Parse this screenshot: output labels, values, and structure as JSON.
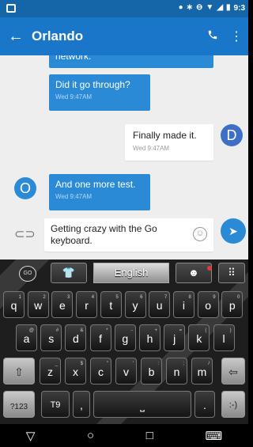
{
  "status_bar": {
    "time": "9:3",
    "icons": [
      "notification-icon",
      "bluetooth-icon",
      "sync-icon",
      "wifi-icon",
      "signal-icon",
      "battery-icon"
    ]
  },
  "app_bar": {
    "title": "Orlando",
    "back_icon": "arrow-left-icon",
    "call_icon": "phone-icon",
    "menu_icon": "more-vert-icon"
  },
  "messages": [
    {
      "direction": "in",
      "text": "network.",
      "time": ""
    },
    {
      "direction": "in",
      "text": "Did it go through?",
      "time": "Wed 9:47AM"
    },
    {
      "direction": "out",
      "text": "Finally made it.",
      "time": "Wed 9:47AM",
      "avatar_letter": "D"
    },
    {
      "direction": "in",
      "text": "And one more test.",
      "time": "Wed 9:47AM",
      "avatar_letter": "O"
    }
  ],
  "composer": {
    "value": "Getting crazy with the Go keyboard.",
    "attach_icon": "paperclip-icon",
    "emoji_icon": "smiley-icon",
    "send_icon": "send-icon"
  },
  "keyboard": {
    "go_label": "GO",
    "language": "English",
    "toolbar_icons": [
      "shirt-icon",
      "emoji-icon",
      "keyboard-grid-icon"
    ],
    "row1": [
      {
        "k": "q",
        "h": "1"
      },
      {
        "k": "w",
        "h": "2"
      },
      {
        "k": "e",
        "h": "3"
      },
      {
        "k": "r",
        "h": "4"
      },
      {
        "k": "t",
        "h": "5"
      },
      {
        "k": "y",
        "h": "6"
      },
      {
        "k": "u",
        "h": "7"
      },
      {
        "k": "i",
        "h": "8"
      },
      {
        "k": "o",
        "h": "9"
      },
      {
        "k": "p",
        "h": "0"
      }
    ],
    "row2": [
      {
        "k": "a",
        "h": "@"
      },
      {
        "k": "s",
        "h": "#"
      },
      {
        "k": "d",
        "h": "&"
      },
      {
        "k": "f",
        "h": "*"
      },
      {
        "k": "g",
        "h": "-"
      },
      {
        "k": "h",
        "h": "+"
      },
      {
        "k": "j",
        "h": "="
      },
      {
        "k": "k",
        "h": "("
      },
      {
        "k": "l",
        "h": ")"
      }
    ],
    "row3": [
      {
        "k": "z",
        "h": "_"
      },
      {
        "k": "x",
        "h": "$"
      },
      {
        "k": "c",
        "h": "\""
      },
      {
        "k": "v",
        "h": "'"
      },
      {
        "k": "b",
        "h": ":"
      },
      {
        "k": "n",
        "h": ";"
      },
      {
        "k": "m",
        "h": "/"
      }
    ],
    "shift": "⇧",
    "backspace": "⇦",
    "sym": "?123",
    "t9": "T9",
    "comma": ",",
    "space": "⎵",
    "period": ".",
    "smiley": ":-)"
  },
  "nav": {
    "back": "▽",
    "home": "○",
    "recents": "□",
    "keyboard": "⌨"
  },
  "colors": {
    "primary": "#1976c8",
    "accent": "#2a8ad6",
    "avatar_d": "#3d6fc6",
    "avatar_o": "#2a8ad6"
  }
}
